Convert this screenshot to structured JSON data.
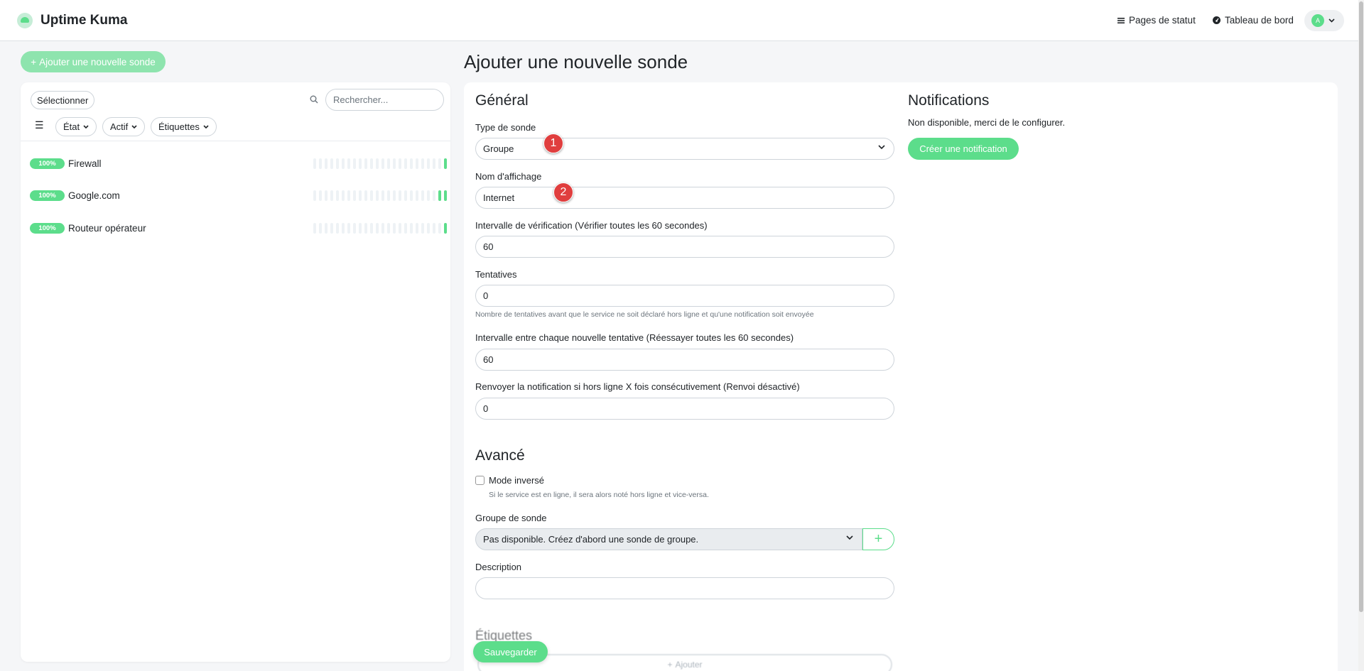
{
  "header": {
    "app_title": "Uptime Kuma",
    "status_pages": "Pages de statut",
    "dashboard": "Tableau de bord",
    "avatar_initial": "A"
  },
  "sidebar": {
    "add_button": "Ajouter une nouvelle sonde",
    "select_button": "Sélectionner",
    "search_placeholder": "Rechercher...",
    "filters": {
      "state": "État",
      "active": "Actif",
      "tags": "Étiquettes"
    },
    "monitors": [
      {
        "uptime": "100%",
        "name": "Firewall",
        "recent_up_beats": 1
      },
      {
        "uptime": "100%",
        "name": "Google.com",
        "recent_up_beats": 2
      },
      {
        "uptime": "100%",
        "name": "Routeur opérateur",
        "recent_up_beats": 1
      }
    ]
  },
  "main": {
    "page_title": "Ajouter une nouvelle sonde",
    "general": {
      "heading": "Général",
      "type_label": "Type de sonde",
      "type_value": "Groupe",
      "name_label": "Nom d'affichage",
      "name_value": "Internet",
      "interval_label": "Intervalle de vérification (Vérifier toutes les 60 secondes)",
      "interval_value": "60",
      "retries_label": "Tentatives",
      "retries_value": "0",
      "retries_help": "Nombre de tentatives avant que le service ne soit déclaré hors ligne et qu'une notification soit envoyée",
      "retry_interval_label": "Intervalle entre chaque nouvelle tentative (Réessayer toutes les 60 secondes)",
      "retry_interval_value": "60",
      "resend_label": "Renvoyer la notification si hors ligne X fois consécutivement (Renvoi désactivé)",
      "resend_value": "0"
    },
    "advanced": {
      "heading": "Avancé",
      "inverse_label": "Mode inversé",
      "inverse_help": "Si le service est en ligne, il sera alors noté hors ligne et vice-versa.",
      "group_label": "Groupe de sonde",
      "group_value": "Pas disponible. Créez d'abord une sonde de groupe.",
      "description_label": "Description",
      "description_value": ""
    },
    "tags": {
      "heading": "Étiquettes",
      "add": "Ajouter"
    },
    "notifications": {
      "heading": "Notifications",
      "text": "Non disponible, merci de le configurer.",
      "create_button": "Créer une notification"
    },
    "save_button": "Sauvegarder"
  },
  "markers": [
    "1",
    "2"
  ],
  "colors": {
    "accent": "#5cdd8b",
    "marker": "#e03e3e"
  }
}
